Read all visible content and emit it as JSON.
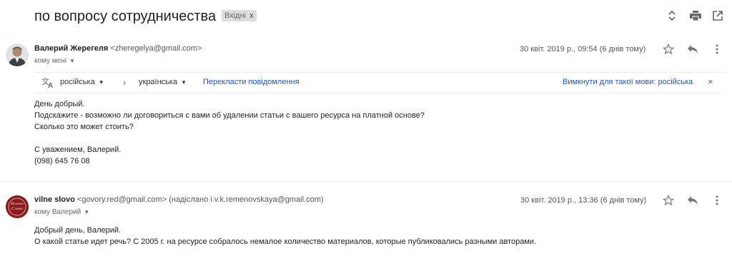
{
  "thread": {
    "subject": "по вопросу сотрудничества",
    "label": "Вхідні",
    "label_close": "x"
  },
  "icons": {
    "expand": "unfold-icon",
    "print": "print-icon",
    "popout": "open-in-new-icon",
    "star": "star-icon",
    "reply": "reply-icon",
    "more": "more-vert-icon",
    "translate": "translate-icon"
  },
  "message1": {
    "sender_name": "Валерий Жерегеля",
    "sender_email": "<zheregelya@gmail.com>",
    "to": "кому мені",
    "date": "30 квіт. 2019 р., 09:54 (6 днів тому)",
    "translate_bar": {
      "source_lang": "російська",
      "arrow": "›",
      "target_lang": "українська",
      "translate_link": "Перекласти повідомлення",
      "disable_link": "Вимкнути для такої мови: російська",
      "close": "×"
    },
    "body": [
      "День добрый.",
      "Подскажите - возможно ли договориться с вами об удалении статьи с вашего ресурса на платной основе?",
      "Сколько это может стоить?",
      "",
      "С уважением, Валерий.",
      "(098) 645 76 08"
    ]
  },
  "message2": {
    "sender_name": "vilne slovo",
    "sender_email": "<govory.red@gmail.com> (надіслано i.v.k.remenovskaya@gmail.com)",
    "to": "кому Валерий",
    "date": "30 квіт. 2019 р., 13:36 (6 днів тому)",
    "avatar_text": "Вільне Слово",
    "body": [
      "Добрый день, Валерий.",
      "О какой статье идет речь? С 2005 г. на ресурсе собралось немалое количество материалов, которые публиковались разными авторами."
    ]
  },
  "colors": {
    "link": "#1a55c4",
    "avatar2_bg": "#8b1a1a"
  }
}
